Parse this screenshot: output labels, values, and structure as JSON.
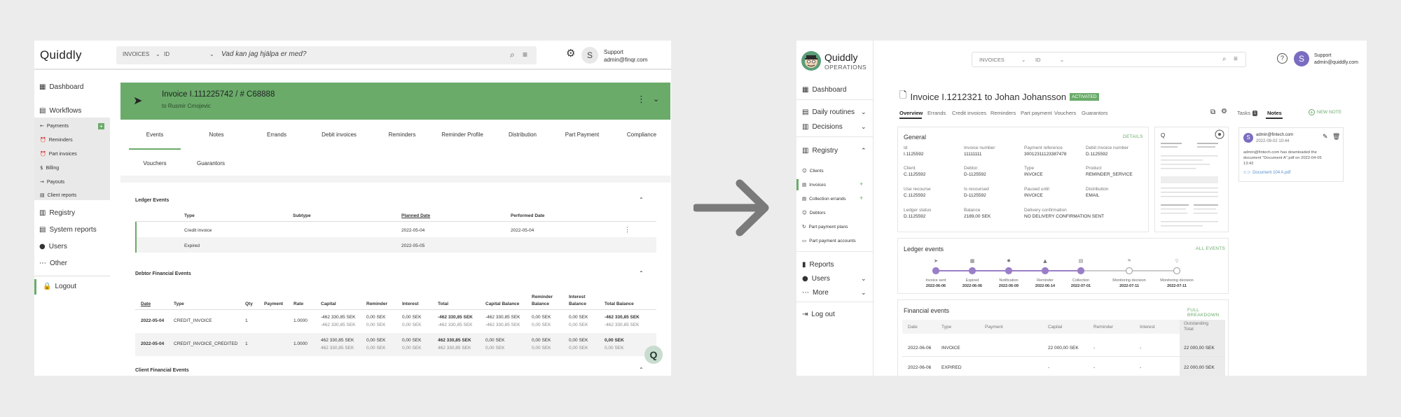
{
  "old": {
    "logo": "Quiddly",
    "search": {
      "type": "INVOICES",
      "field": "ID",
      "placeholder": "Vad kan jag hjälpa er med?"
    },
    "user": {
      "initial": "S",
      "name": "Support",
      "email": "admin@finqr.com"
    },
    "nav": {
      "dashboard": "Dashboard",
      "workflows": "Workflows",
      "sub": [
        "Payments",
        "Reminders",
        "Part invoices",
        "Billing",
        "Payouts",
        "Client reports"
      ],
      "registry": "Registry",
      "system_reports": "System reports",
      "users": "Users",
      "other": "Other",
      "logout": "Logout"
    },
    "invoice": {
      "title": "Invoice I.111225742 / # C68888",
      "subtitle": "to Rusmir Crnojevic"
    },
    "tabs": [
      "Events",
      "Notes",
      "Errands",
      "Debit invoices",
      "Reminders",
      "Reminder Profile",
      "Distribution",
      "Part Payment",
      "Compliance"
    ],
    "tabs2": [
      "Vouchers",
      "Guarantors"
    ],
    "ledger": {
      "title": "Ledger Events",
      "headers": [
        "Type",
        "Subtype",
        "Planned Date",
        "Performed Date"
      ],
      "rows": [
        {
          "type": "Credit invoice",
          "subtype": "",
          "planned": "2022-05-04",
          "performed": "2022-05-04"
        },
        {
          "type": "Expired",
          "subtype": "",
          "planned": "2022-05-05",
          "performed": ""
        }
      ]
    },
    "debtor": {
      "title": "Debtor Financial Events",
      "headers": [
        "Date",
        "Type",
        "Qty",
        "Payment",
        "Rate",
        "Capital",
        "Reminder",
        "Interest",
        "Total",
        "Capital Balance",
        "Reminder Balance",
        "Interest Balance",
        "Total Balance"
      ],
      "rows": [
        {
          "date": "2022-05-04",
          "type": "CREDIT_INVOICE",
          "qty": "1",
          "rate": "1.0000",
          "capital": "-462 330,85 SEK",
          "capital2": "-462 330,85 SEK",
          "reminder": "0,00 SEK",
          "reminder2": "0,00 SEK",
          "interest": "0,00 SEK",
          "interest2": "0,00 SEK",
          "total": "-462 330,85 SEK",
          "total2": "-462 330,85 SEK",
          "capbal": "-462 330,85 SEK",
          "capbal2": "-462 330,85 SEK",
          "rembal": "0,00 SEK",
          "rembal2": "0,00 SEK",
          "intbal": "0,00 SEK",
          "intbal2": "0,00 SEK",
          "totbal": "-462 330,85 SEK",
          "totbal2": "-462 330,85 SEK"
        },
        {
          "date": "2022-05-04",
          "type": "CREDIT_INVOICE_CREDITED",
          "qty": "1",
          "rate": "1.0000",
          "capital": "462 330,85 SEK",
          "capital2": "462 330,85 SEK",
          "reminder": "0,00 SEK",
          "reminder2": "0,00 SEK",
          "interest": "0,00 SEK",
          "interest2": "0,00 SEK",
          "total": "462 330,85 SEK",
          "total2": "462 330,85 SEK",
          "capbal": "0,00 SEK",
          "capbal2": "0,00 SEK",
          "rembal": "0,00 SEK",
          "rembal2": "0,00 SEK",
          "intbal": "0,00 SEK",
          "intbal2": "0,00 SEK",
          "totbal": "0,00 SEK",
          "totbal2": "0,00 SEK"
        }
      ]
    },
    "client": {
      "title": "Client Financial Events"
    },
    "help_glyph": "Q"
  },
  "new": {
    "logo": "Quiddly",
    "logo_sub": "OPERATIONS",
    "search": {
      "type": "INVOICES",
      "field": "ID"
    },
    "user": {
      "initial": "S",
      "name": "Support",
      "email": "admin@quiddly.com"
    },
    "nav": {
      "dashboard": "Dashboard",
      "daily": "Daily routines",
      "decisions": "Decisions",
      "registry": "Registry",
      "sub": [
        "Clients",
        "Invoices",
        "Collection errands",
        "Debtors",
        "Part payment plans",
        "Part payment accounts"
      ],
      "reports": "Reports",
      "users": "Users",
      "more": "More",
      "logout": "Log out"
    },
    "invoice": {
      "title": "Invoice I.1212321 to Johan Johansson",
      "status": "ACTIVATED"
    },
    "tabs": [
      "Overview",
      "Errands",
      "Credit invoices",
      "Reminders",
      "Part payment",
      "Vouchers",
      "Guarantors"
    ],
    "tasks": {
      "label": "Tasks",
      "count": "1"
    },
    "notes_tab": "Notes",
    "new_note": "NEW NOTE",
    "general": {
      "title": "General",
      "details": "DETAILS",
      "fields": [
        {
          "label": "Id",
          "value": "I.1125592"
        },
        {
          "label": "Invoice number",
          "value": "11111111"
        },
        {
          "label": "Payment reference",
          "value": "30012311123387478"
        },
        {
          "label": "Debit invoice number",
          "value": "D.1125592"
        },
        {
          "label": "Client",
          "value": "C.1125592"
        },
        {
          "label": "Debtor",
          "value": "D-1125592"
        },
        {
          "label": "Type",
          "value": "INVOICE"
        },
        {
          "label": "Product",
          "value": "REMINDER_SERVICE"
        },
        {
          "label": "Use recourse",
          "value": "C.1125592"
        },
        {
          "label": "Is recoursed",
          "value": "D-1125592"
        },
        {
          "label": "Paused until",
          "value": "INVOICE"
        },
        {
          "label": "Distribution",
          "value": "EMAIL"
        },
        {
          "label": "Ledger status",
          "value": "D.1125592"
        },
        {
          "label": "Balance",
          "value": "2189,00 SEK"
        },
        {
          "label": "Delivery confirmation",
          "value": "NO DELIVERY CONFIRMATION SENT"
        }
      ]
    },
    "note": {
      "initial": "S",
      "author": "admin@fintech.com",
      "date": "2022-09-02 10:44",
      "text": [
        "admin@fintech.com has downloaded the",
        "document \"Document A\".pdf on 2022-04-05",
        "13:42"
      ],
      "attachment": "Document 104 A.pdf"
    },
    "ledger": {
      "title": "Ledger events",
      "link": "ALL EVENTS",
      "events": [
        {
          "name": "Invoice sent",
          "date": "2022-06-06",
          "done": true
        },
        {
          "name": "Expired",
          "date": "2022-06-06",
          "done": true
        },
        {
          "name": "Notification",
          "date": "2022-06-09",
          "done": true
        },
        {
          "name": "Reminder",
          "date": "2022-06-14",
          "done": true
        },
        {
          "name": "Collection",
          "date": "2022-07-01",
          "done": true
        },
        {
          "name": "Monitoring decision",
          "date": "2022-07-11",
          "done": false
        },
        {
          "name": "Monitoring decision",
          "date": "2022-07-11",
          "done": false
        }
      ]
    },
    "financial": {
      "title": "Financial events",
      "link": "FULL BREAKDOWN",
      "headers": [
        "Date",
        "Type",
        "Payment",
        "Capital",
        "Reminder",
        "Interest",
        "Outstanding Total"
      ],
      "rows": [
        {
          "date": "2022-06-06",
          "type": "INVOICE",
          "payment": "",
          "capital": "22 000,00 SEK",
          "reminder": "-",
          "interest": "-",
          "total": "22 000,00 SEK"
        },
        {
          "date": "2022-06-06",
          "type": "EXPIRED",
          "payment": "",
          "capital": "-",
          "reminder": "-",
          "interest": "-",
          "total": "22 000,00 SEK"
        }
      ]
    }
  },
  "colors": {
    "accent_green": "#6aab6a",
    "purple": "#9a7ec7",
    "arrow": "#7a7a7a",
    "avatar_purple": "#7a6cc0"
  }
}
